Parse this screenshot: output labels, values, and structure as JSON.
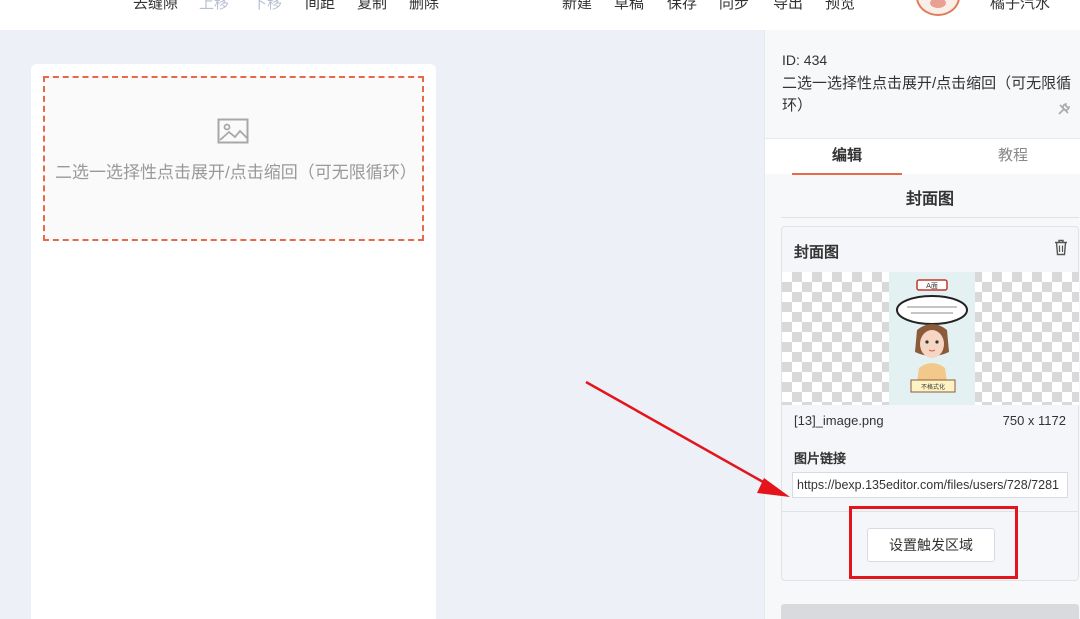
{
  "toolbar": {
    "left_items": [
      {
        "label": "去缝隙",
        "state": "enabled"
      },
      {
        "label": "上移",
        "state": "disabled"
      },
      {
        "label": "下移",
        "state": "disabled"
      },
      {
        "label": "间距",
        "state": "enabled"
      },
      {
        "label": "复制",
        "state": "enabled"
      },
      {
        "label": "删除",
        "state": "enabled"
      }
    ],
    "right_items": [
      "新建",
      "草稿",
      "保存",
      "同步",
      "导出",
      "预览"
    ],
    "username": "橘子汽水"
  },
  "canvas": {
    "placeholder_icon": "image-icon",
    "placeholder_text": "二选一选择性点击展开/点击缩回（可无限循环）"
  },
  "panel": {
    "id_label": "ID: 434",
    "title": "二选一选择性点击展开/点击缩回（可无限循环）",
    "tabs": [
      {
        "label": "编辑",
        "active": true
      },
      {
        "label": "教程",
        "active": false
      }
    ],
    "section_title": "封面图",
    "cover_card": {
      "title": "封面图",
      "image_caption": "A面",
      "image_text": "不格式化",
      "file_name": "[13]_image.png",
      "dimensions": "750 x 1172",
      "link_label": "图片链接",
      "link_value": "https://bexp.135editor.com/files/users/728/7281",
      "trigger_button_label": "设置触发区域"
    }
  },
  "colors": {
    "accent": "#e8694a",
    "annotation_red": "#e3141b",
    "background": "#eef0f8"
  }
}
